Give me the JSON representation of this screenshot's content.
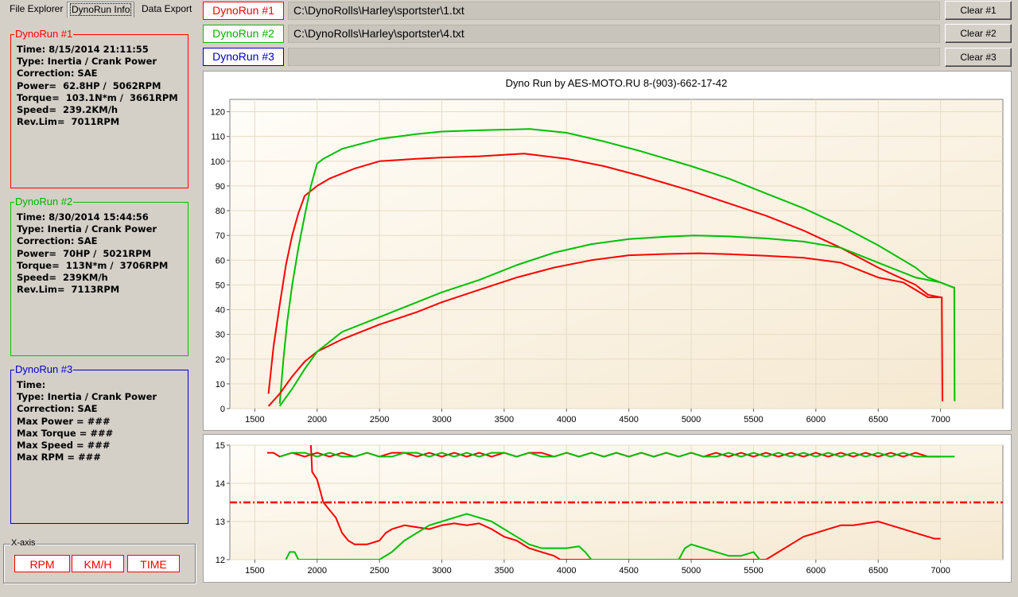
{
  "tabs": [
    {
      "label": "File Explorer",
      "active": false
    },
    {
      "label": "DynoRun Info",
      "active": true
    },
    {
      "label": "Data Export",
      "active": false
    }
  ],
  "runs": [
    {
      "title": "DynoRun #1",
      "color": "#ff0000",
      "lines": [
        "Time: 8/15/2014 21:11:55",
        "Type: Inertia / Crank Power",
        "Correction: SAE",
        "Power=  62.8HP /  5062RPM",
        "Torque=  103.1N*m /  3661RPM",
        "Speed=  239.2KM/h",
        "Rev.Lim=  7011RPM"
      ],
      "path": "C:\\DynoRolls\\Harley\\sportster\\1.txt",
      "clear_label": "Clear #1"
    },
    {
      "title": "DynoRun #2",
      "color": "#00c000",
      "lines": [
        "Time: 8/30/2014 15:44:56",
        "Type: Inertia / Crank Power",
        "Correction: SAE",
        "Power=  70HP /  5021RPM",
        "Torque=  113N*m /  3706RPM",
        "Speed=  239KM/h",
        "Rev.Lim=  7113RPM"
      ],
      "path": "C:\\DynoRolls\\Harley\\sportster\\4.txt",
      "clear_label": "Clear #2"
    },
    {
      "title": "DynoRun #3",
      "color": "#0000c0",
      "lines": [
        "Time:",
        "Type: Inertia / Crank Power",
        "Correction: SAE",
        "Max Power = ###",
        "Max Torque = ###",
        "Max Speed = ###",
        "Max RPM = ###"
      ],
      "path": "",
      "clear_label": "Clear #3"
    }
  ],
  "xaxis_group": {
    "legend": "X-axis",
    "buttons": [
      "RPM",
      "KM/H",
      "TIME"
    ]
  },
  "chart_data": [
    {
      "type": "line",
      "title": "Dyno Run by AES-MOTO.RU    8-(903)-662-17-42",
      "xlim": [
        1300,
        7500
      ],
      "ylim": [
        0,
        125
      ],
      "xticks": [
        1500,
        2000,
        2500,
        3000,
        3500,
        4000,
        4500,
        5000,
        5500,
        6000,
        6500,
        7000
      ],
      "yticks": [
        0,
        10,
        20,
        30,
        40,
        50,
        60,
        70,
        80,
        90,
        100,
        110,
        120
      ],
      "series": [
        {
          "role": "torque-run1",
          "color": "#ff0000",
          "x": [
            1610,
            1650,
            1700,
            1750,
            1800,
            1850,
            1900,
            2000,
            2100,
            2300,
            2500,
            2800,
            3000,
            3300,
            3661,
            4000,
            4300,
            4600,
            5000,
            5300,
            5600,
            5900,
            6200,
            6500,
            6800,
            6900,
            7000,
            7010,
            7015
          ],
          "y": [
            6,
            25,
            42,
            58,
            70,
            79,
            86,
            90,
            93,
            97,
            100,
            101,
            101.5,
            102,
            103.1,
            101,
            98,
            94,
            88,
            83,
            78,
            72,
            65,
            57,
            50,
            46,
            45,
            45,
            3
          ]
        },
        {
          "role": "torque-run2",
          "color": "#00c000",
          "x": [
            1700,
            1730,
            1760,
            1800,
            1850,
            1900,
            1950,
            2000,
            2050,
            2200,
            2500,
            2800,
            3000,
            3300,
            3706,
            4000,
            4300,
            4600,
            5000,
            5300,
            5600,
            5900,
            6200,
            6500,
            6800,
            6900,
            7000,
            7100,
            7110,
            7113
          ],
          "y": [
            2,
            20,
            35,
            50,
            65,
            78,
            90,
            99,
            101,
            105,
            109,
            111,
            112,
            112.5,
            113,
            111.5,
            108,
            104,
            98,
            93,
            87,
            81,
            74,
            66,
            57,
            53,
            51,
            49,
            49,
            3
          ]
        },
        {
          "role": "power-run1",
          "color": "#ff0000",
          "x": [
            1610,
            1700,
            1800,
            1900,
            2000,
            2200,
            2500,
            2800,
            3000,
            3300,
            3600,
            3900,
            4200,
            4500,
            4800,
            5062,
            5300,
            5600,
            5900,
            6200,
            6500,
            6700,
            6900,
            7000,
            7010
          ],
          "y": [
            1,
            6,
            13,
            19,
            23,
            28,
            34,
            39,
            43,
            48,
            53,
            57,
            60,
            62,
            62.5,
            62.8,
            62.4,
            61.8,
            61,
            59,
            53,
            51,
            45,
            45,
            45
          ]
        },
        {
          "role": "power-run2",
          "color": "#00c000",
          "x": [
            1700,
            1800,
            1900,
            2000,
            2200,
            2500,
            2800,
            3000,
            3300,
            3600,
            3900,
            4200,
            4500,
            4800,
            5021,
            5300,
            5600,
            5900,
            6200,
            6500,
            6800,
            7000,
            7100,
            7113
          ],
          "y": [
            1,
            8,
            16,
            23,
            31,
            37,
            43,
            47,
            52,
            58,
            63,
            66.5,
            68.5,
            69.5,
            70,
            69.6,
            68.8,
            67.5,
            65,
            59,
            53,
            51,
            49,
            49
          ]
        }
      ]
    },
    {
      "type": "line",
      "xlim": [
        1300,
        7500
      ],
      "ylim": [
        12,
        15
      ],
      "xticks": [
        1500,
        2000,
        2500,
        3000,
        3500,
        4000,
        4500,
        5000,
        5500,
        6000,
        6500,
        7000
      ],
      "yticks": [
        12,
        13,
        14,
        15
      ],
      "reference_line": {
        "y": 13.5,
        "color": "#ff0000"
      },
      "series": [
        {
          "role": "afr-run1-top",
          "color": "#ff0000",
          "x": [
            1600,
            1650,
            1700,
            1800,
            1900,
            2000,
            2100,
            2200,
            2300,
            2400,
            2500,
            2600,
            2700,
            2800,
            2900,
            3000,
            3100,
            3200,
            3300,
            3400,
            3500,
            3600,
            3700,
            3800,
            3900,
            4000,
            4100,
            4200,
            4300,
            4400,
            4500,
            4600,
            4700,
            4800,
            4900,
            5000,
            5100,
            5200,
            5300,
            5400,
            5500,
            5600,
            5700,
            5800,
            5900,
            6000,
            6100,
            6200,
            6300,
            6400,
            6500,
            6600,
            6700,
            6800,
            6900,
            7000
          ],
          "y": [
            14.8,
            14.8,
            14.7,
            14.8,
            14.7,
            14.8,
            14.7,
            14.8,
            14.7,
            14.8,
            14.7,
            14.8,
            14.8,
            14.7,
            14.8,
            14.7,
            14.8,
            14.7,
            14.8,
            14.7,
            14.8,
            14.7,
            14.8,
            14.8,
            14.7,
            14.8,
            14.7,
            14.8,
            14.7,
            14.8,
            14.7,
            14.8,
            14.7,
            14.8,
            14.7,
            14.8,
            14.7,
            14.8,
            14.7,
            14.8,
            14.7,
            14.8,
            14.7,
            14.8,
            14.7,
            14.8,
            14.7,
            14.8,
            14.7,
            14.8,
            14.7,
            14.8,
            14.7,
            14.8,
            14.7,
            14.7
          ]
        },
        {
          "role": "afr-run2-top",
          "color": "#00c000",
          "x": [
            1700,
            1800,
            1900,
            2000,
            2100,
            2200,
            2300,
            2400,
            2500,
            2600,
            2700,
            2800,
            2900,
            3000,
            3100,
            3200,
            3300,
            3400,
            3500,
            3600,
            3700,
            3800,
            3900,
            4000,
            4100,
            4200,
            4300,
            4400,
            4500,
            4600,
            4700,
            4800,
            4900,
            5000,
            5100,
            5200,
            5300,
            5400,
            5500,
            5600,
            5700,
            5800,
            5900,
            6000,
            6100,
            6200,
            6300,
            6400,
            6500,
            6600,
            6700,
            6800,
            6900,
            7000,
            7100,
            7113
          ],
          "y": [
            14.7,
            14.8,
            14.8,
            14.7,
            14.8,
            14.7,
            14.7,
            14.8,
            14.7,
            14.7,
            14.8,
            14.8,
            14.7,
            14.8,
            14.7,
            14.8,
            14.7,
            14.8,
            14.8,
            14.7,
            14.8,
            14.7,
            14.7,
            14.8,
            14.7,
            14.8,
            14.7,
            14.8,
            14.7,
            14.8,
            14.7,
            14.8,
            14.7,
            14.8,
            14.7,
            14.7,
            14.8,
            14.7,
            14.8,
            14.7,
            14.8,
            14.7,
            14.8,
            14.7,
            14.8,
            14.7,
            14.8,
            14.7,
            14.8,
            14.7,
            14.8,
            14.7,
            14.7,
            14.7,
            14.7,
            14.7
          ]
        },
        {
          "role": "afr-run1-low",
          "color": "#ff0000",
          "x": [
            1950,
            1960,
            2000,
            2050,
            2100,
            2150,
            2200,
            2250,
            2300,
            2400,
            2500,
            2550,
            2600,
            2700,
            2800,
            2900,
            3000,
            3100,
            3200,
            3300,
            3400,
            3500,
            3600,
            3700,
            3800,
            3900,
            3950,
            5600,
            5700,
            5800,
            5900,
            6000,
            6100,
            6200,
            6300,
            6400,
            6500,
            6600,
            6700,
            6800,
            6900,
            6950,
            7000
          ],
          "y": [
            15,
            14.3,
            14.1,
            13.5,
            13.3,
            13.1,
            12.7,
            12.5,
            12.4,
            12.4,
            12.5,
            12.7,
            12.8,
            12.9,
            12.85,
            12.8,
            12.9,
            12.95,
            12.9,
            12.95,
            12.8,
            12.6,
            12.5,
            12.3,
            12.2,
            12.1,
            12.0,
            12.0,
            12.2,
            12.4,
            12.6,
            12.7,
            12.8,
            12.9,
            12.9,
            12.95,
            13.0,
            12.9,
            12.8,
            12.7,
            12.6,
            12.55,
            12.55
          ]
        },
        {
          "role": "afr-run2-low",
          "color": "#00c000",
          "x": [
            1750,
            1780,
            1820,
            1850,
            2500,
            2600,
            2700,
            2800,
            2900,
            3000,
            3100,
            3200,
            3300,
            3400,
            3500,
            3600,
            3700,
            3800,
            4000,
            4100,
            4150,
            4200,
            4900,
            4950,
            5000,
            5100,
            5200,
            5300,
            5400,
            5500,
            5550
          ],
          "y": [
            12.0,
            12.2,
            12.2,
            12.0,
            12.0,
            12.2,
            12.5,
            12.7,
            12.9,
            13.0,
            13.1,
            13.2,
            13.1,
            13.0,
            12.8,
            12.6,
            12.4,
            12.3,
            12.3,
            12.35,
            12.2,
            12.0,
            12.0,
            12.3,
            12.4,
            12.3,
            12.2,
            12.1,
            12.1,
            12.2,
            12.0
          ]
        }
      ]
    }
  ]
}
